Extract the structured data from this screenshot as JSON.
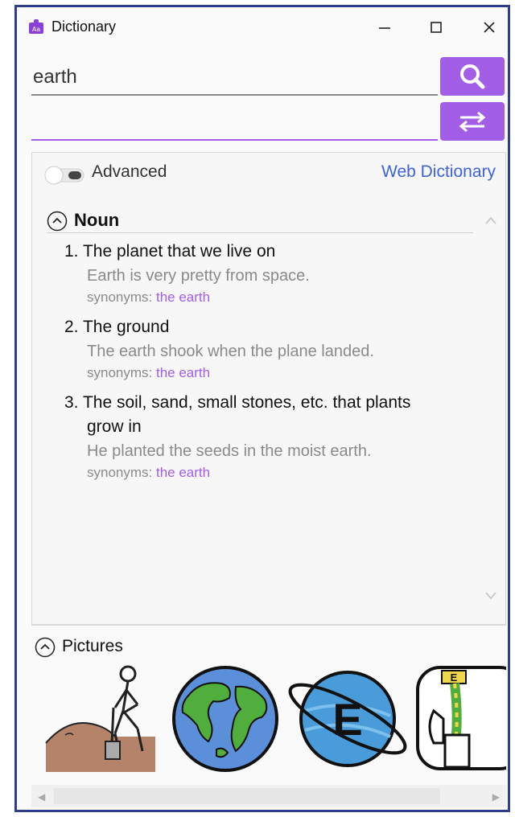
{
  "window": {
    "title": "Dictionary"
  },
  "search": {
    "value": "earth"
  },
  "options": {
    "advanced_label": "Advanced",
    "advanced_on": false,
    "web_dictionary_label": "Web Dictionary"
  },
  "sections": {
    "noun_label": "Noun",
    "pictures_label": "Pictures"
  },
  "definitions": [
    {
      "number": "1.",
      "text": "The planet that we live on",
      "text_cont": "",
      "example": "Earth is very pretty from space.",
      "synonyms_label": "synonyms:",
      "synonym": "the earth"
    },
    {
      "number": "2.",
      "text": "The ground",
      "text_cont": "",
      "example": "The earth shook when the plane landed.",
      "synonyms_label": "synonyms:",
      "synonym": "the earth"
    },
    {
      "number": "3.",
      "text": "The soil, sand, small stones, etc. that plants",
      "text_cont": "grow in",
      "example": "He planted the seeds in the moist earth.",
      "synonyms_label": "synonyms:",
      "synonym": "the earth"
    }
  ],
  "pictures": [
    {
      "icon": "digging-soil-icon"
    },
    {
      "icon": "globe-icon"
    },
    {
      "icon": "planet-e-icon"
    },
    {
      "icon": "earth-wire-icon"
    }
  ],
  "colors": {
    "accent": "#a35ee8",
    "link": "#3d63d9",
    "window_border": "#2f3d8f"
  },
  "pic_letters": {
    "planet": "E",
    "wire_tag": "E"
  }
}
